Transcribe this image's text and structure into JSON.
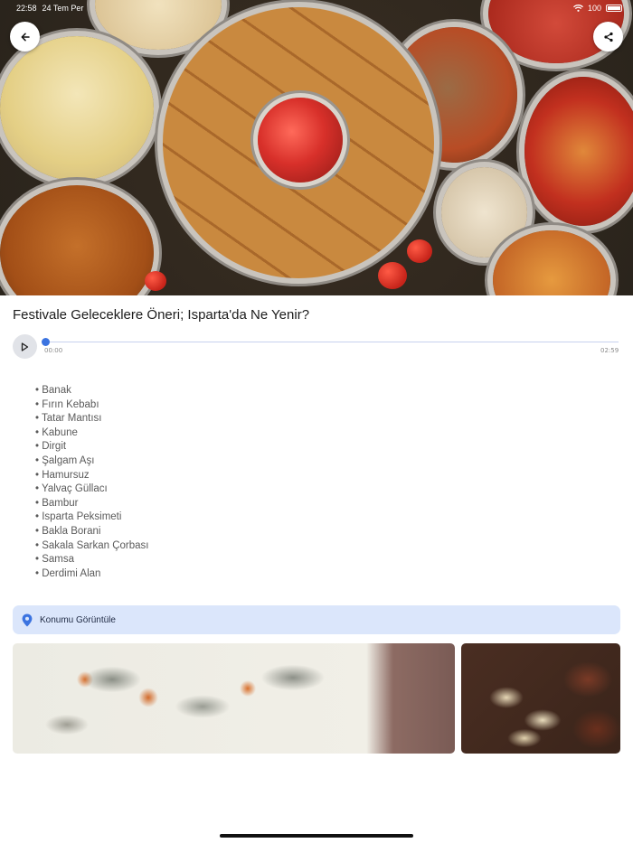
{
  "status_bar": {
    "time": "22:58",
    "date": "24 Tem Per",
    "battery": "100"
  },
  "header": {
    "back_icon": "arrow-left-icon",
    "share_icon": "share-icon"
  },
  "article": {
    "title": "Festivale Geleceklere Öneri; Isparta'da Ne Yenir?"
  },
  "audio": {
    "current_time": "00:00",
    "duration": "02:59",
    "progress": 0,
    "accent_color": "#3b73e0"
  },
  "food_list": [
    "Banak",
    "Fırın Kebabı",
    "Tatar Mantısı",
    "Kabune",
    "Dirgit",
    "Şalgam Aşı",
    "Hamursuz",
    "Yalvaç Güllacı",
    "Bambur",
    "Isparta Peksimeti",
    "Bakla Borani",
    "Sakala Sarkan Çorbası",
    "Samsa",
    "Derdimi Alan"
  ],
  "location": {
    "label": "Konumu Görüntüle",
    "icon": "location-pin-icon",
    "background_color": "#dbe6fb"
  }
}
